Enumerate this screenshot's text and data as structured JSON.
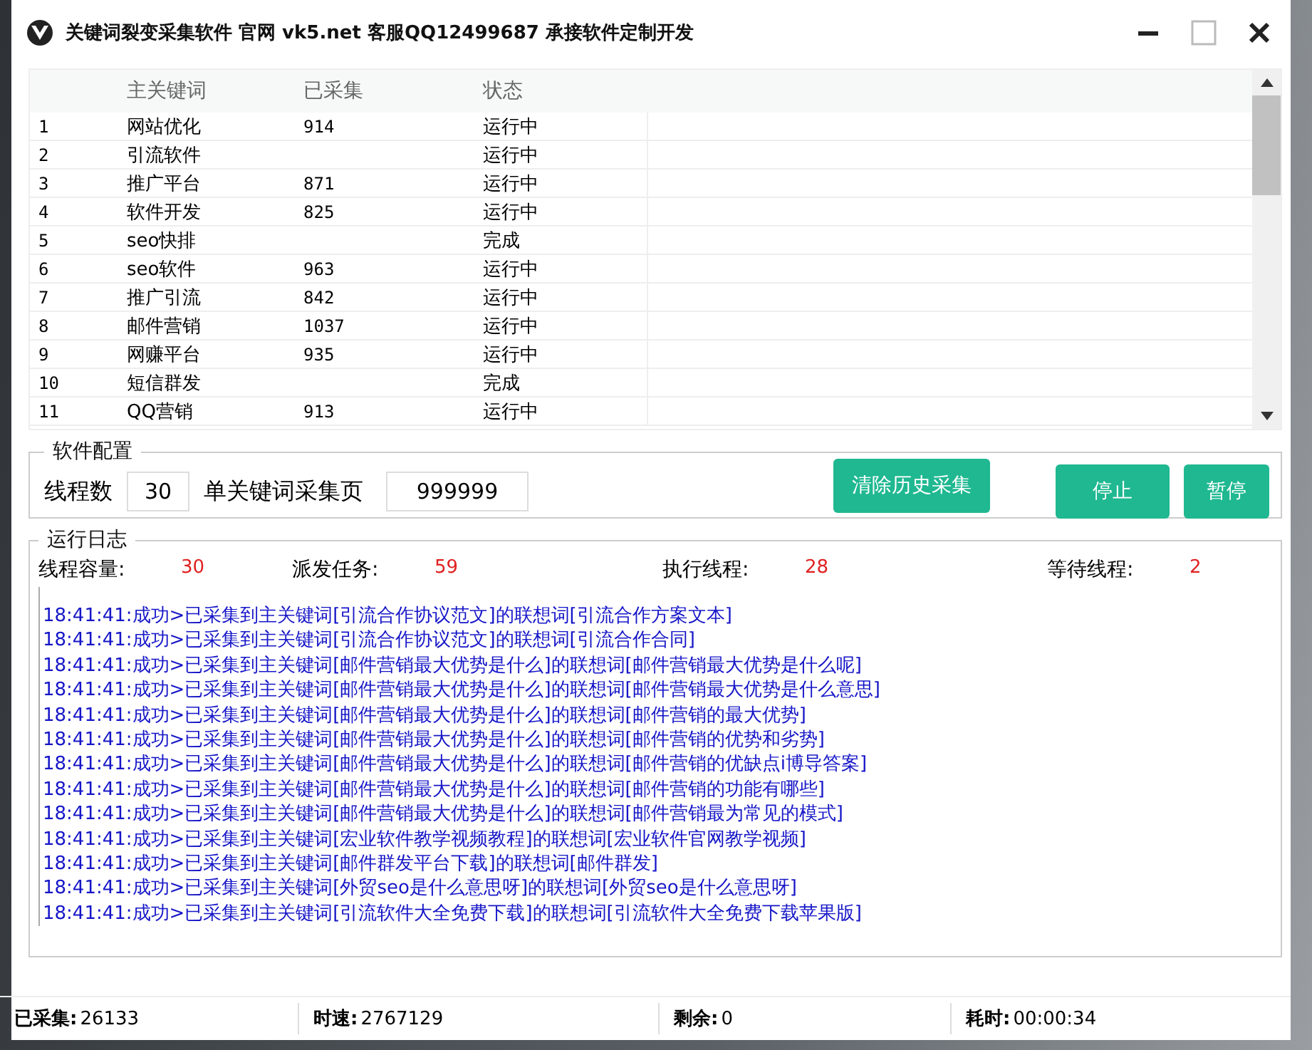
{
  "window": {
    "title": "关键词裂变采集软件 官网 vk5.net 客服QQ12499687 承接软件定制开发"
  },
  "table": {
    "columns": [
      "主关键词",
      "已采集",
      "状态"
    ],
    "rows": [
      {
        "index": "1",
        "keyword": "网站优化",
        "collected": "914",
        "status": "运行中"
      },
      {
        "index": "2",
        "keyword": "引流软件",
        "status": "运行中"
      },
      {
        "index": "3",
        "keyword": "推广平台",
        "collected": "871",
        "status": "运行中"
      },
      {
        "index": "4",
        "keyword": "软件开发",
        "collected": "825",
        "status": "运行中"
      },
      {
        "index": "5",
        "keyword": "seo快排",
        "status": "完成"
      },
      {
        "index": "6",
        "keyword": "seo软件",
        "collected": "963",
        "status": "运行中"
      },
      {
        "index": "7",
        "keyword": "推广引流",
        "collected": "842",
        "status": "运行中"
      },
      {
        "index": "8",
        "keyword": "邮件营销",
        "collected": "1037",
        "status": "运行中"
      },
      {
        "index": "9",
        "keyword": "网赚平台",
        "collected": "935",
        "status": "运行中"
      },
      {
        "index": "10",
        "keyword": "短信群发",
        "status": "完成"
      },
      {
        "index": "11",
        "keyword": "QQ营销",
        "collected": "913",
        "status": "运行中"
      }
    ]
  },
  "config": {
    "title": "软件配置",
    "threads_label": "线程数",
    "threads_value": "30",
    "pages_label": "单关键词采集页",
    "pages_value": "999999",
    "buttons": [
      "清除历史采集",
      "停止",
      "暂停"
    ]
  },
  "log": {
    "title": "运行日志",
    "counters": [
      {
        "label": "线程容量:",
        "value": "30"
      },
      {
        "label": "派发任务:",
        "value": "59"
      },
      {
        "label": "执行线程:",
        "value": "28"
      },
      {
        "label": "等待线程:",
        "value": "2"
      }
    ],
    "lines": [
      "18:41:41:成功>已采集到主关键词[引流合作协议范文]的联想词[引流合作方案文本]",
      "18:41:41:成功>已采集到主关键词[引流合作协议范文]的联想词[引流合作合同]",
      "18:41:41:成功>已采集到主关键词[邮件营销最大优势是什么]的联想词[邮件营销最大优势是什么呢]",
      "18:41:41:成功>已采集到主关键词[邮件营销最大优势是什么]的联想词[邮件营销最大优势是什么意思]",
      "18:41:41:成功>已采集到主关键词[邮件营销最大优势是什么]的联想词[邮件营销的最大优势]",
      "18:41:41:成功>已采集到主关键词[邮件营销最大优势是什么]的联想词[邮件营销的优势和劣势]",
      "18:41:41:成功>已采集到主关键词[邮件营销最大优势是什么]的联想词[邮件营销的优缺点i博导答案]",
      "18:41:41:成功>已采集到主关键词[邮件营销最大优势是什么]的联想词[邮件营销的功能有哪些]",
      "18:41:41:成功>已采集到主关键词[邮件营销最大优势是什么]的联想词[邮件营销最为常见的模式]",
      "18:41:41:成功>已采集到主关键词[宏业软件教学视频教程]的联想词[宏业软件官网教学视频]",
      "18:41:41:成功>已采集到主关键词[邮件群发平台下载]的联想词[邮件群发]",
      "18:41:41:成功>已采集到主关键词[外贸seo是什么意思呀]的联想词[外贸seo是什么意思呀]",
      "18:41:41:成功>已采集到主关键词[引流软件大全免费下载]的联想词[引流软件大全免费下载苹果版]"
    ]
  },
  "status_bar": [
    {
      "label": "已采集:",
      "value": "26133"
    },
    {
      "label": "时速:",
      "value": "2767129"
    },
    {
      "label": "剩余:",
      "value": "0"
    },
    {
      "label": "耗时:",
      "value": "00:00:34"
    }
  ]
}
